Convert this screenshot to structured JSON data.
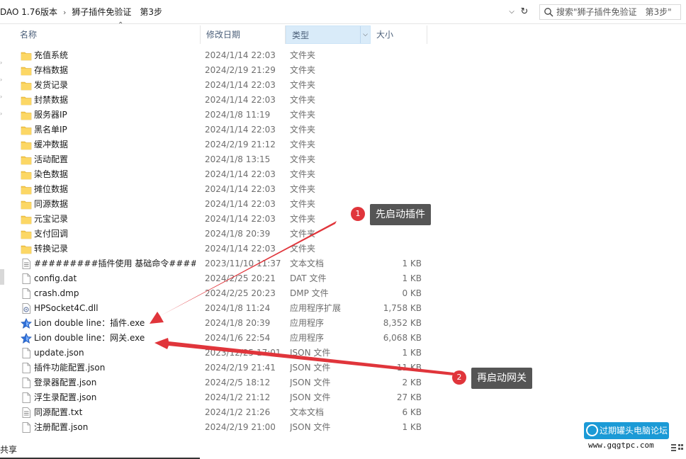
{
  "address": {
    "segments": [
      "DAO 1.76版本",
      "狮子插件免验证　第3步"
    ],
    "search_placeholder": "搜索\"狮子插件免验证　第3步\""
  },
  "columns": {
    "name": "名称",
    "date": "修改日期",
    "type": "类型",
    "size": "大小"
  },
  "files": [
    {
      "icon": "folder-icon",
      "name": "充值系统",
      "date": "2024/1/14 22:03",
      "type": "文件夹",
      "size": ""
    },
    {
      "icon": "folder-icon",
      "name": "存档数据",
      "date": "2024/2/19 21:29",
      "type": "文件夹",
      "size": ""
    },
    {
      "icon": "folder-icon",
      "name": "发货记录",
      "date": "2024/1/14 22:03",
      "type": "文件夹",
      "size": ""
    },
    {
      "icon": "folder-icon",
      "name": "封禁数据",
      "date": "2024/1/14 22:03",
      "type": "文件夹",
      "size": ""
    },
    {
      "icon": "folder-icon",
      "name": "服务器IP",
      "date": "2024/1/8 11:19",
      "type": "文件夹",
      "size": ""
    },
    {
      "icon": "folder-icon",
      "name": "黑名单IP",
      "date": "2024/1/14 22:03",
      "type": "文件夹",
      "size": ""
    },
    {
      "icon": "folder-icon",
      "name": "缓冲数据",
      "date": "2024/2/19 21:12",
      "type": "文件夹",
      "size": ""
    },
    {
      "icon": "folder-icon",
      "name": "活动配置",
      "date": "2024/1/8 13:15",
      "type": "文件夹",
      "size": ""
    },
    {
      "icon": "folder-icon",
      "name": "染色数据",
      "date": "2024/1/14 22:03",
      "type": "文件夹",
      "size": ""
    },
    {
      "icon": "folder-icon",
      "name": "摊位数据",
      "date": "2024/1/14 22:03",
      "type": "文件夹",
      "size": ""
    },
    {
      "icon": "folder-icon",
      "name": "同源数据",
      "date": "2024/1/14 22:03",
      "type": "文件夹",
      "size": ""
    },
    {
      "icon": "folder-icon",
      "name": "元宝记录",
      "date": "2024/1/14 22:03",
      "type": "文件夹",
      "size": ""
    },
    {
      "icon": "folder-icon",
      "name": "支付回调",
      "date": "2024/1/8 20:39",
      "type": "文件夹",
      "size": ""
    },
    {
      "icon": "folder-icon",
      "name": "转换记录",
      "date": "2024/1/14 22:03",
      "type": "文件夹",
      "size": ""
    },
    {
      "icon": "text-file-icon",
      "name": "#########插件使用 基础命令#####...",
      "date": "2023/11/10 11:37",
      "type": "文本文档",
      "size": "1 KB"
    },
    {
      "icon": "file-icon",
      "name": "config.dat",
      "date": "2024/2/25 20:21",
      "type": "DAT 文件",
      "size": "1 KB"
    },
    {
      "icon": "file-icon",
      "name": "crash.dmp",
      "date": "2024/2/25 20:23",
      "type": "DMP 文件",
      "size": "0 KB"
    },
    {
      "icon": "dll-icon",
      "name": "HPSocket4C.dll",
      "date": "2024/1/8 11:24",
      "type": "应用程序扩展",
      "size": "1,758 KB"
    },
    {
      "icon": "exe-star-icon",
      "name": "Lion double line：插件.exe",
      "date": "2024/1/8 20:39",
      "type": "应用程序",
      "size": "8,352 KB"
    },
    {
      "icon": "exe-star-icon",
      "name": "Lion double line：网关.exe",
      "date": "2024/1/6 22:54",
      "type": "应用程序",
      "size": "6,068 KB"
    },
    {
      "icon": "file-icon",
      "name": "update.json",
      "date": "2023/12/25 17:01",
      "type": "JSON 文件",
      "size": "1 KB"
    },
    {
      "icon": "file-icon",
      "name": "插件功能配置.json",
      "date": "2024/2/19 21:41",
      "type": "JSON 文件",
      "size": "11 KB"
    },
    {
      "icon": "file-icon",
      "name": "登录器配置.json",
      "date": "2024/2/5 18:12",
      "type": "JSON 文件",
      "size": "2 KB"
    },
    {
      "icon": "file-icon",
      "name": "浮生录配置.json",
      "date": "2024/1/2 21:12",
      "type": "JSON 文件",
      "size": "27 KB"
    },
    {
      "icon": "text-file-icon",
      "name": "同源配置.txt",
      "date": "2024/1/2 21:26",
      "type": "文本文档",
      "size": "6 KB"
    },
    {
      "icon": "file-icon",
      "name": "注册配置.json",
      "date": "2024/2/19 21:00",
      "type": "JSON 文件",
      "size": "1 KB"
    }
  ],
  "annotations": {
    "step1": {
      "number": "1",
      "text": "先启动插件"
    },
    "step2": {
      "number": "2",
      "text": "再启动网关"
    }
  },
  "status": {
    "text": "共享"
  },
  "watermark": {
    "title": "过期罐头电脑论坛",
    "url": "www.gqgtpc.com"
  },
  "colors": {
    "folder": "#f6c94f",
    "header_sorted": "#d9ebf9",
    "callout": "#555555",
    "badge": "#e0353b",
    "arrow": "#e0353b"
  }
}
